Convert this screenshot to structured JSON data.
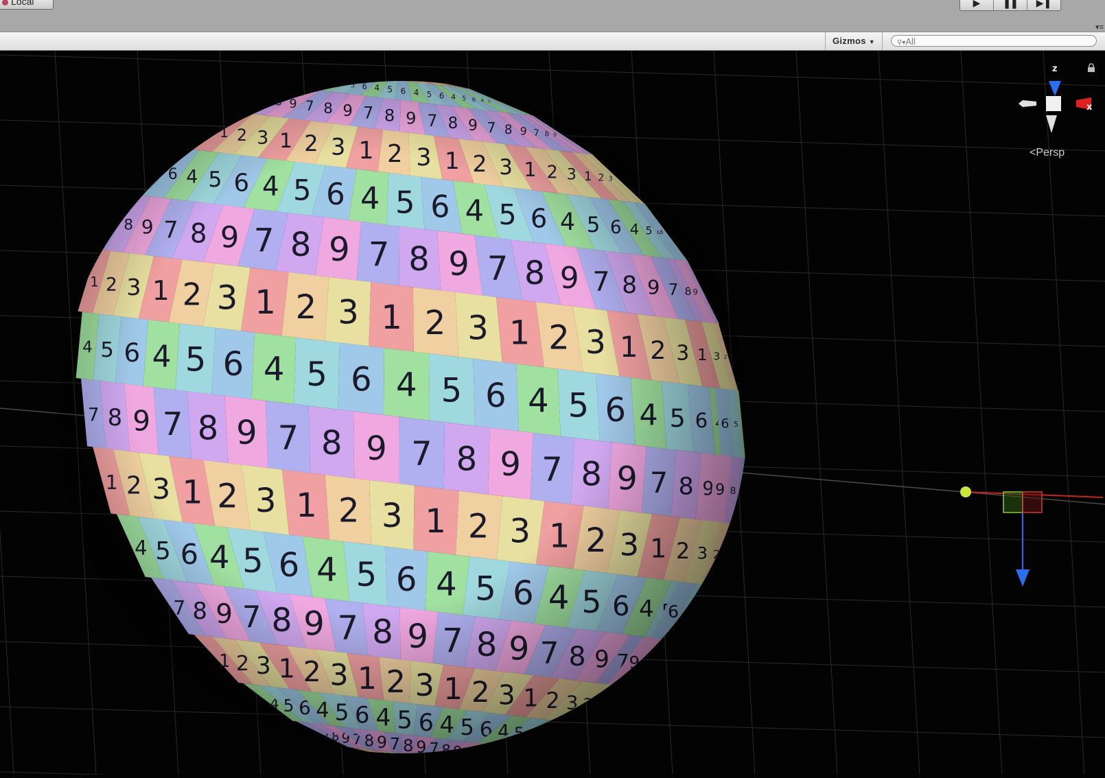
{
  "toolbar": {
    "local_label": "Local",
    "play_icon": "play-icon",
    "pause_icon": "pause-icon",
    "step_icon": "step-icon"
  },
  "scene_bar": {
    "gizmos_label": "Gizmos",
    "search_placeholder": "All"
  },
  "scene_gizmo": {
    "z_label": "z",
    "x_label": "x",
    "projection_label": "Persp"
  },
  "sphere": {
    "texture_digits": [
      "1",
      "2",
      "3",
      "4",
      "5",
      "6",
      "7",
      "8",
      "9"
    ]
  },
  "colors": {
    "toolbar_bg": "#a8a8a8",
    "viewport_bg": "#040303",
    "axis_x": "#e02020",
    "axis_y": "#a8e020",
    "axis_z": "#2a6ff0"
  }
}
